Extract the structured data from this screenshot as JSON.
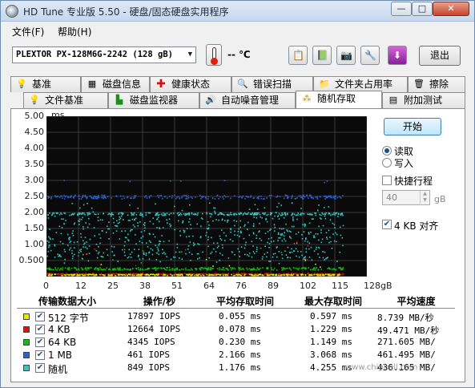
{
  "window": {
    "title": "HD Tune 专业版 5.50 - 硬盘/固态硬盘实用程序",
    "min_label": "—",
    "max_label": "□",
    "close_label": "✕"
  },
  "menu": {
    "file": "文件(F)",
    "help": "帮助(H)"
  },
  "toolbar": {
    "drive": "PLEXTOR PX-128M6G-2242 (128 gB)",
    "temperature": "-- ℃",
    "exit": "退出"
  },
  "tabs_row1": [
    {
      "label": "基准",
      "icon": "bulb-icon"
    },
    {
      "label": "磁盘信息",
      "icon": "disk-info-icon"
    },
    {
      "label": "健康状态",
      "icon": "health-cross-icon"
    },
    {
      "label": "错误扫描",
      "icon": "magnifier-icon"
    },
    {
      "label": "文件夹占用率",
      "icon": "folder-icon"
    },
    {
      "label": "擦除",
      "icon": "trash-icon"
    }
  ],
  "tabs_row2": [
    {
      "label": "文件基准",
      "icon": "file-bulb-icon"
    },
    {
      "label": "磁盘监视器",
      "icon": "monitor-chart-icon"
    },
    {
      "label": "自动噪音管理",
      "icon": "speaker-icon"
    },
    {
      "label": "随机存取",
      "icon": "random-access-icon",
      "active": true
    },
    {
      "label": "附加测试",
      "icon": "extra-tests-icon"
    }
  ],
  "chart_data": {
    "type": "scatter",
    "title": "",
    "ylabel": "ms",
    "xlabel": "",
    "x_ticks": [
      "0",
      "12",
      "25",
      "38",
      "51",
      "64",
      "76",
      "89",
      "102",
      "115",
      "128gB"
    ],
    "y_ticks": [
      "5.00",
      "4.50",
      "4.00",
      "3.50",
      "3.00",
      "2.50",
      "2.00",
      "1.50",
      "1.00",
      "0.500"
    ],
    "xlim": [
      0,
      128
    ],
    "ylim": [
      0,
      5
    ],
    "grid": true,
    "series": [
      {
        "name": "512 字节",
        "color": "#e8e800",
        "avg_ms": 0.055,
        "max_ms": 0.597
      },
      {
        "name": "4 KB",
        "color": "#e01010",
        "avg_ms": 0.078,
        "max_ms": 1.229
      },
      {
        "name": "64 KB",
        "color": "#10c010",
        "avg_ms": 0.23,
        "max_ms": 1.149
      },
      {
        "name": "1 MB",
        "color": "#2a62d8",
        "avg_ms": 2.166,
        "max_ms": 3.068
      },
      {
        "name": "随机",
        "color": "#30c8c8",
        "avg_ms": 1.176,
        "max_ms": 4.255
      }
    ]
  },
  "side": {
    "start": "开始",
    "read": "读取",
    "write": "写入",
    "short_stroke": "快捷行程",
    "stroke_value": "40",
    "stroke_unit": "gB",
    "align": "4 KB 对齐"
  },
  "table": {
    "headers": [
      "传输数据大小",
      "操作/秒",
      "平均存取时间",
      "最大存取时间",
      "平均速度"
    ],
    "rows": [
      {
        "size": "512 字节",
        "ops": "17897 IOPS",
        "avg": "0.055 ms",
        "max": "0.597 ms",
        "speed": "8.739 MB/秒",
        "color": "#e8e800"
      },
      {
        "size": "4 KB",
        "ops": "12664 IOPS",
        "avg": "0.078 ms",
        "max": "1.229 ms",
        "speed": "49.471 MB/秒",
        "color": "#e01010"
      },
      {
        "size": "64 KB",
        "ops": "4345 IOPS",
        "avg": "0.230 ms",
        "max": "1.149 ms",
        "speed": "271.605 MB/",
        "color": "#10c010"
      },
      {
        "size": "1 MB",
        "ops": "461 IOPS",
        "avg": "2.166 ms",
        "max": "3.068 ms",
        "speed": "461.495 MB/",
        "color": "#2a62d8"
      },
      {
        "size": "随机",
        "ops": "849 IOPS",
        "avg": "1.176 ms",
        "max": "4.255 ms",
        "speed": "436.165 MB/",
        "color": "#30c8c8"
      }
    ]
  },
  "watermark": "www.chiphell.com"
}
